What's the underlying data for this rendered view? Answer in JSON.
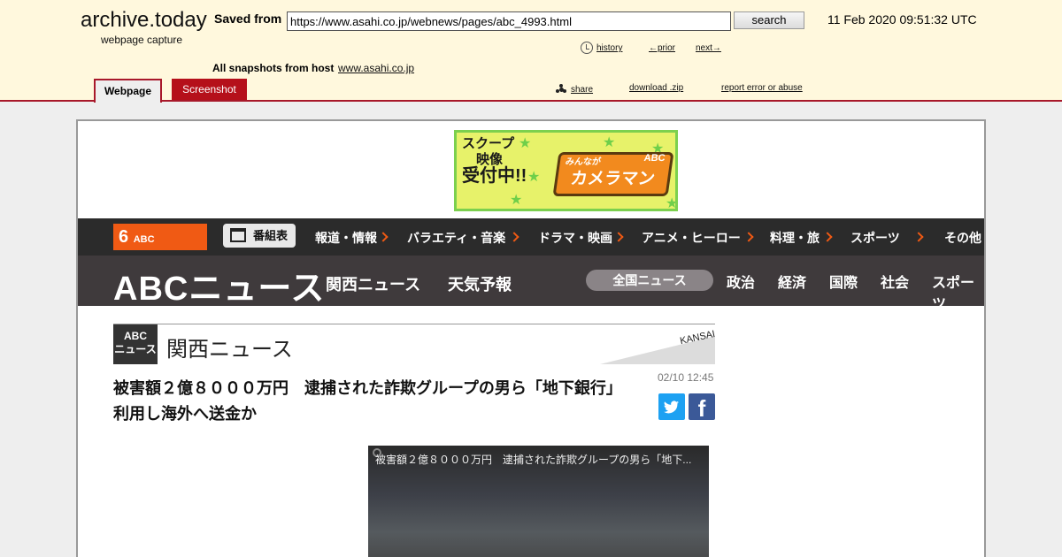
{
  "archive": {
    "logo": "archive.today",
    "logo_sub": "webpage capture",
    "saved_from_label": "Saved from",
    "url": "https://www.asahi.co.jp/webnews/pages/abc_4993.html",
    "search_label": "search",
    "timestamp": "11 Feb 2020 09:51:32 UTC",
    "history_label": "history",
    "prior_label": "←prior",
    "next_label": "next→",
    "snapshots_label": "All snapshots  from host",
    "host": "www.asahi.co.jp",
    "share_label": "share",
    "download_label": "download .zip",
    "report_label": "report error or abuse",
    "tab_webpage": "Webpage",
    "tab_screenshot": "Screenshot",
    "accent_color": "#a8182a"
  },
  "ad": {
    "line1": "スクープ",
    "line2": "映像",
    "line3": "受付中!!",
    "brand": "カメラマン",
    "brand_small": "ABC",
    "brand_prefix": "みんなが"
  },
  "nav1": {
    "logo_num": "6",
    "logo_text": "ABC",
    "program_label": "番組表",
    "items": [
      "報道・情報",
      "バラエティ・音楽",
      "ドラマ・映画",
      "アニメ・ヒーロー",
      "料理・旅",
      "スポーツ",
      "その他"
    ]
  },
  "nav2": {
    "logo": "ABCニュース",
    "kansai": "関西ニュース",
    "weather": "天気予報",
    "national_pill": "全国ニュース",
    "categories": [
      "政治",
      "経済",
      "国際",
      "社会",
      "スポーツ"
    ]
  },
  "section": {
    "logo_line1": "ABC",
    "logo_line2": "ニュース",
    "title": "関西ニュース",
    "tag": "KANSAI"
  },
  "article": {
    "headline": "被害額２億８０００万円　逮捕された詐欺グループの男ら「地下銀行」利用し海外へ送金か",
    "date": "02/10 12:45",
    "video_title": "被害額２億８０００万円　逮捕された詐欺グループの男ら「地下..."
  }
}
